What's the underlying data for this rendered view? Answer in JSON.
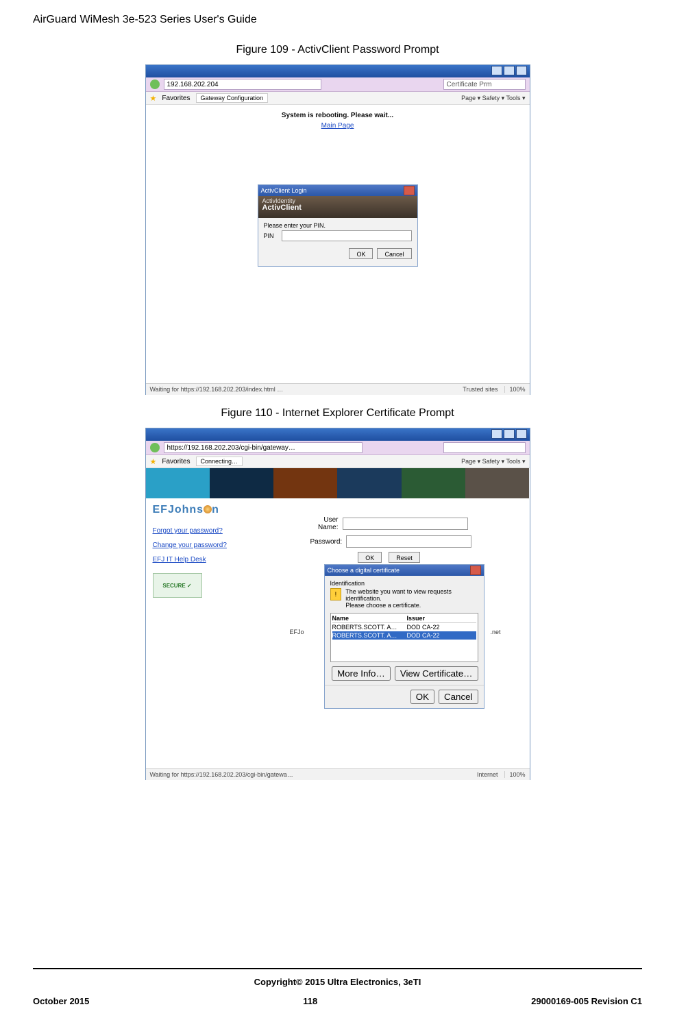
{
  "header": {
    "running": "AirGuard WiMesh 3e-523 Series User's Guide"
  },
  "fig109": {
    "caption": "Figure 109 - ActivClient Password Prompt",
    "browser": {
      "url": "192.168.202.204",
      "search": "Certificate Prm",
      "fav": "Favorites",
      "tab": "Gateway Configuration",
      "tools": "Page ▾  Safety ▾  Tools ▾",
      "status_left": "Waiting for https://192.168.202.203/index.html …",
      "status_trust": "Trusted sites",
      "status_zoom": "100%"
    },
    "page": {
      "sysmsg": "System is rebooting. Please wait...",
      "mainlink": "Main Page"
    },
    "activ": {
      "title": "ActivClient Login",
      "brand_top": "ActivIdentity",
      "brand_main": "ActivClient",
      "enter": "Please enter your PIN.",
      "pin_label": "PIN",
      "ok": "OK",
      "cancel": "Cancel"
    }
  },
  "fig110": {
    "caption": "Figure 110 - Internet Explorer Certificate Prompt",
    "browser": {
      "url": "https://192.168.202.203/cgi-bin/gateway…",
      "search": "",
      "fav": "Favorites",
      "tab": "Connecting…",
      "tools": "Page ▾  Safety ▾  Tools ▾",
      "status_left": "Waiting for https://192.168.202.203/cgi-bin/gatewa…",
      "status_net": "Internet",
      "status_zoom": "100%"
    },
    "brand": {
      "ef": "EFJohns",
      "n": "n"
    },
    "links": {
      "forgot": "Forgot your password?",
      "change": "Change your password?",
      "help": "EFJ IT Help Desk"
    },
    "secure": "SECURE ✓",
    "login": {
      "user_label": "User Name:",
      "pass_label": "Password:",
      "ok": "OK",
      "reset": "Reset"
    },
    "midlabel": {
      "left": "EFJo",
      "right": ".net"
    },
    "cert": {
      "title": "Choose a digital certificate",
      "section": "Identification",
      "msg1": "The website you want to view requests identification.",
      "msg2": "Please choose a certificate.",
      "col_name": "Name",
      "col_issuer": "Issuer",
      "row1_name": "ROBERTS.SCOTT. A…",
      "row1_issuer": "DOD CA-22",
      "row2_name": "ROBERTS.SCOTT. A…",
      "row2_issuer": "DOD CA-22",
      "more": "More Info…",
      "view": "View Certificate…",
      "ok": "OK",
      "cancel": "Cancel"
    }
  },
  "footer": {
    "copyright_prefix": "Copyright",
    "copyright_symbol": "©",
    "copyright_rest": " 2015 Ultra Electronics, 3eTI",
    "left": "October 2015",
    "center": "118",
    "right": "29000169-005 Revision C1"
  }
}
